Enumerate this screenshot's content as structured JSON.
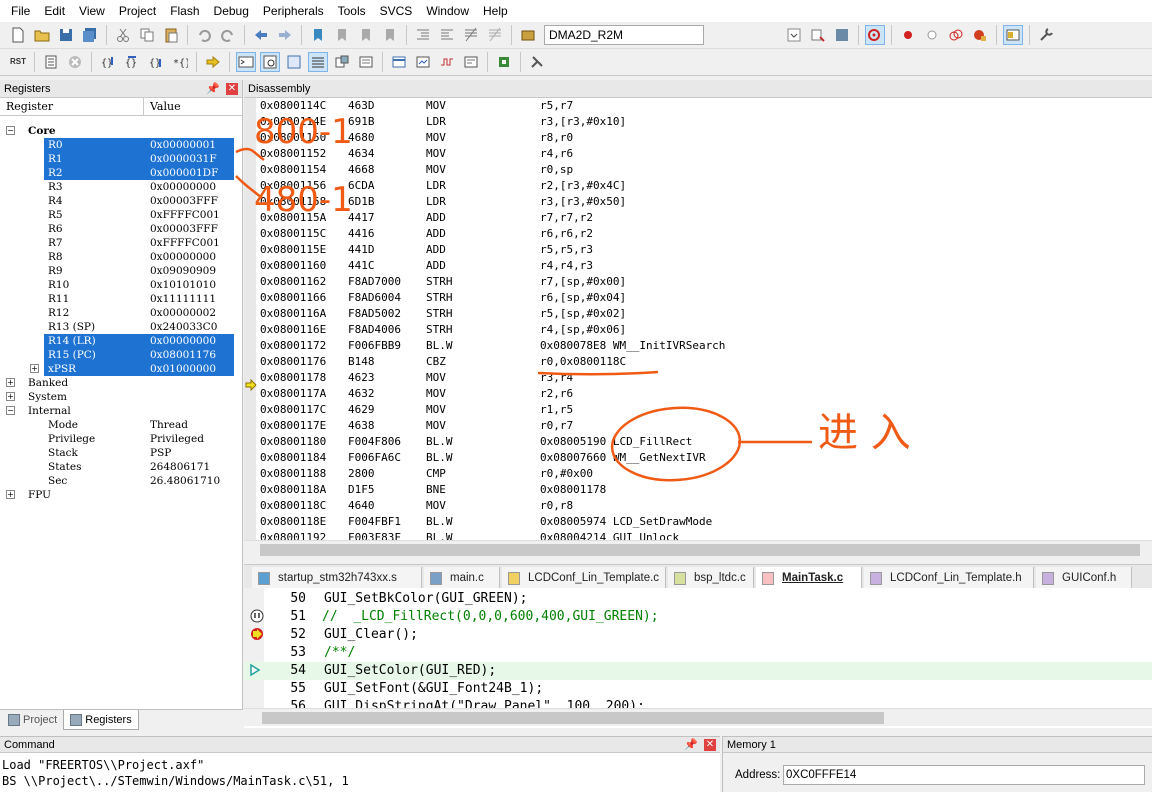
{
  "menu": [
    "File",
    "Edit",
    "View",
    "Project",
    "Flash",
    "Debug",
    "Peripherals",
    "Tools",
    "SVCS",
    "Window",
    "Help"
  ],
  "toolbar": {
    "target": "DMA2D_R2M",
    "rst_label": "RST"
  },
  "registers": {
    "title": "Registers",
    "col_register": "Register",
    "col_value": "Value",
    "core_label": "Core",
    "core": [
      {
        "name": "R0",
        "value": "0x00000001",
        "selected": true
      },
      {
        "name": "R1",
        "value": "0x0000031F",
        "selected": true
      },
      {
        "name": "R2",
        "value": "0x000001DF",
        "selected": true
      },
      {
        "name": "R3",
        "value": "0x00000000",
        "selected": false
      },
      {
        "name": "R4",
        "value": "0x00003FFF",
        "selected": false
      },
      {
        "name": "R5",
        "value": "0xFFFFC001",
        "selected": false
      },
      {
        "name": "R6",
        "value": "0x00003FFF",
        "selected": false
      },
      {
        "name": "R7",
        "value": "0xFFFFC001",
        "selected": false
      },
      {
        "name": "R8",
        "value": "0x00000000",
        "selected": false
      },
      {
        "name": "R9",
        "value": "0x09090909",
        "selected": false
      },
      {
        "name": "R10",
        "value": "0x10101010",
        "selected": false
      },
      {
        "name": "R11",
        "value": "0x11111111",
        "selected": false
      },
      {
        "name": "R12",
        "value": "0x00000002",
        "selected": false
      },
      {
        "name": "R13 (SP)",
        "value": "0x240033C0",
        "selected": false
      },
      {
        "name": "R14 (LR)",
        "value": "0x00000000",
        "selected": true
      },
      {
        "name": "R15 (PC)",
        "value": "0x08001176",
        "selected": true
      },
      {
        "name": "xPSR",
        "value": "0x01000000",
        "selected": true
      }
    ],
    "groups": [
      "Banked",
      "System",
      "Internal"
    ],
    "internal": [
      {
        "name": "Mode",
        "value": "Thread"
      },
      {
        "name": "Privilege",
        "value": "Privileged"
      },
      {
        "name": "Stack",
        "value": "PSP"
      },
      {
        "name": "States",
        "value": "264806171"
      },
      {
        "name": "Sec",
        "value": "26.48061710"
      }
    ],
    "fpu_label": "FPU"
  },
  "left_tabs": {
    "project": "Project",
    "registers": "Registers"
  },
  "disassembly": {
    "title": "Disassembly",
    "lines": [
      [
        "0x0800114C",
        "463D",
        "MOV",
        "r5,r7"
      ],
      [
        "0x0800114E",
        "691B",
        "LDR",
        "r3,[r3,#0x10]"
      ],
      [
        "0x08001150",
        "4680",
        "MOV",
        "r8,r0"
      ],
      [
        "0x08001152",
        "4634",
        "MOV",
        "r4,r6"
      ],
      [
        "0x08001154",
        "4668",
        "MOV",
        "r0,sp"
      ],
      [
        "0x08001156",
        "6CDA",
        "LDR",
        "r2,[r3,#0x4C]"
      ],
      [
        "0x08001158",
        "6D1B",
        "LDR",
        "r3,[r3,#0x50]"
      ],
      [
        "0x0800115A",
        "4417",
        "ADD",
        "r7,r7,r2"
      ],
      [
        "0x0800115C",
        "4416",
        "ADD",
        "r6,r6,r2"
      ],
      [
        "0x0800115E",
        "441D",
        "ADD",
        "r5,r5,r3"
      ],
      [
        "0x08001160",
        "441C",
        "ADD",
        "r4,r4,r3"
      ],
      [
        "0x08001162",
        "F8AD7000",
        "STRH",
        "r7,[sp,#0x00]"
      ],
      [
        "0x08001166",
        "F8AD6004",
        "STRH",
        "r6,[sp,#0x04]"
      ],
      [
        "0x0800116A",
        "F8AD5002",
        "STRH",
        "r5,[sp,#0x02]"
      ],
      [
        "0x0800116E",
        "F8AD4006",
        "STRH",
        "r4,[sp,#0x06]"
      ],
      [
        "0x08001172",
        "F006FBB9",
        "BL.W",
        "0x080078E8 WM__InitIVRSearch"
      ],
      [
        "0x08001176",
        "B148",
        "CBZ",
        "r0,0x0800118C"
      ],
      [
        "0x08001178",
        "4623",
        "MOV",
        "r3,r4"
      ],
      [
        "0x0800117A",
        "4632",
        "MOV",
        "r2,r6"
      ],
      [
        "0x0800117C",
        "4629",
        "MOV",
        "r1,r5"
      ],
      [
        "0x0800117E",
        "4638",
        "MOV",
        "r0,r7"
      ],
      [
        "0x08001180",
        "F004F806",
        "BL.W",
        "0x08005190 LCD_FillRect"
      ],
      [
        "0x08001184",
        "F006FA6C",
        "BL.W",
        "0x08007660 WM__GetNextIVR"
      ],
      [
        "0x08001188",
        "2800",
        "CMP",
        "r0,#0x00"
      ],
      [
        "0x0800118A",
        "D1F5",
        "BNE",
        "0x08001178"
      ],
      [
        "0x0800118C",
        "4640",
        "MOV",
        "r0,r8"
      ],
      [
        "0x0800118E",
        "F004FBF1",
        "BL.W",
        "0x08005974 LCD_SetDrawMode"
      ],
      [
        "0x08001192",
        "F003F83F",
        "BL.W",
        "0x08004214 GUI_Unlock"
      ]
    ]
  },
  "editor_tabs": [
    {
      "label": "startup_stm32h743xx.s",
      "active": false,
      "color": "#5aa0d0"
    },
    {
      "label": "main.c",
      "active": false,
      "color": "#7aa0c8"
    },
    {
      "label": "LCDConf_Lin_Template.c",
      "active": false,
      "color": "#f0d060"
    },
    {
      "label": "bsp_ltdc.c",
      "active": false,
      "color": "#d8e0a0"
    },
    {
      "label": "MainTask.c",
      "active": true,
      "color": "#f8c0c0"
    },
    {
      "label": "LCDConf_Lin_Template.h",
      "active": false,
      "color": "#c8b0e0"
    },
    {
      "label": "GUIConf.h",
      "active": false,
      "color": "#c8b0e0"
    }
  ],
  "code": [
    {
      "num": "50",
      "text": "GUI_SetBkColor(GUI_GREEN);",
      "comment": false
    },
    {
      "num": "51",
      "text": "//  _LCD_FillRect(0,0,0,600,400,GUI_GREEN);",
      "comment": true
    },
    {
      "num": "52",
      "text": "GUI_Clear();",
      "comment": false
    },
    {
      "num": "53",
      "text": "/**/",
      "comment": true
    },
    {
      "num": "54",
      "text": "GUI_SetColor(GUI_RED);",
      "comment": false
    },
    {
      "num": "55",
      "text": "GUI_SetFont(&GUI_Font24B_1);",
      "comment": false
    },
    {
      "num": "56",
      "text": "GUI_DispStringAt(\"Draw Panel\", 100, 200);",
      "comment": false
    }
  ],
  "command": {
    "title": "Command",
    "lines": [
      "Load \"FREERTOS\\\\Project.axf\"",
      "BS \\\\Project\\../STemwin/Windows/MainTask.c\\51, 1"
    ]
  },
  "memory": {
    "title": "Memory 1",
    "address_label": "Address:",
    "address": "0XC0FFFE14"
  },
  "annotations": {
    "note1": "800-1",
    "note2": "480-1",
    "enter": "进 入"
  },
  "colors": {
    "selection": "#1e73d2",
    "annotation": "#f05a14",
    "comment": "#008000"
  }
}
